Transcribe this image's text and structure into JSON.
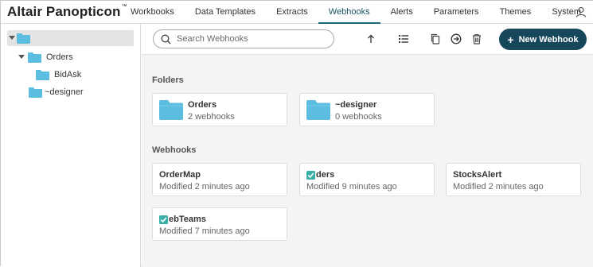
{
  "app": {
    "logo": "Altair Panopticon",
    "logo_mark": "™"
  },
  "nav": {
    "items": [
      {
        "label": "Workbooks",
        "active": false
      },
      {
        "label": "Data Templates",
        "active": false
      },
      {
        "label": "Extracts",
        "active": false
      },
      {
        "label": "Webhooks",
        "active": true
      },
      {
        "label": "Alerts",
        "active": false
      },
      {
        "label": "Parameters",
        "active": false
      },
      {
        "label": "Themes",
        "active": false
      },
      {
        "label": "System",
        "active": false
      }
    ],
    "user_icon": "user-icon"
  },
  "sidebar": {
    "root": {
      "label": ""
    },
    "items": [
      {
        "label": "Orders",
        "expanded": true
      },
      {
        "label": "BidAsk"
      },
      {
        "label": "~designer"
      }
    ]
  },
  "toolbar": {
    "search_placeholder": "Search Webhooks",
    "new_button_label": "New Webhook",
    "icons": [
      "arrow-up-icon",
      "list-view-icon",
      "copy-icon",
      "move-icon",
      "delete-icon"
    ]
  },
  "folders": {
    "title": "Folders",
    "items": [
      {
        "name": "Orders",
        "count": "2 webhooks"
      },
      {
        "name": "~designer",
        "count": "0 webhooks"
      }
    ]
  },
  "webhooks": {
    "title": "Webhooks",
    "items": [
      {
        "name": "OrderMap",
        "modified": "Modified 2 minutes ago",
        "checked": false
      },
      {
        "name": "ders",
        "modified": "Modified 9 minutes ago",
        "checked": true
      },
      {
        "name": "StocksAlert",
        "modified": "Modified 2 minutes ago",
        "checked": false
      },
      {
        "name": "ebTeams",
        "modified": "Modified 7 minutes ago",
        "checked": true
      }
    ]
  },
  "colors": {
    "folder": "#5bbde0",
    "accent": "#17475a",
    "active_tab": "#1a6a7a",
    "check": "#3ab0a8"
  }
}
